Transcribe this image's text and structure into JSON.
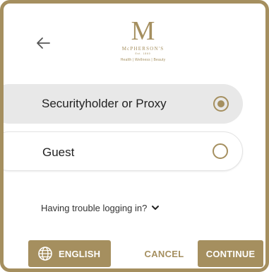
{
  "header": {
    "back_icon": "arrow-left-icon",
    "logo": {
      "mark": "M",
      "brand": "McPHERSON'S",
      "est": "Est. 1860",
      "tagline": "Health | Wellness | Beauty"
    }
  },
  "options": [
    {
      "label": "Securityholder or Proxy",
      "selected": true
    },
    {
      "label": "Guest",
      "selected": false
    }
  ],
  "help": {
    "label": "Having trouble logging in?",
    "icon": "chevron-down-icon"
  },
  "footer": {
    "language_label": "ENGLISH",
    "language_icon": "globe-icon",
    "cancel_label": "CANCEL",
    "continue_label": "CONTINUE"
  },
  "colors": {
    "accent": "#a58f5f",
    "selected_bg": "#e8e8e8",
    "text": "#222222"
  }
}
